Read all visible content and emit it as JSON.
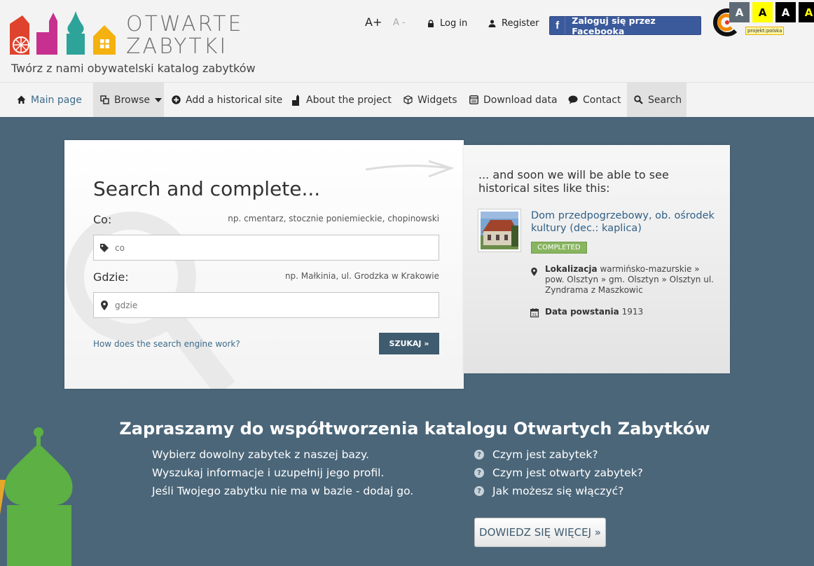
{
  "header": {
    "logo_line1": "OTWARTE",
    "logo_line2": "ZABYTKI",
    "tagline": "Twórz z nami obywatelski katalog zabytków",
    "font_increase": "A+",
    "font_decrease": "A -",
    "login": "Log in",
    "register": "Register",
    "facebook_icon": "f",
    "facebook_login": "Zaloguj się przez Facebooka",
    "partner_logo_text": "projekt:polska",
    "contrast_buttons": [
      "A",
      "A",
      "A",
      "A"
    ]
  },
  "nav": {
    "main": "Main page",
    "browse": "Browse",
    "add": "Add a historical site",
    "about": "About the project",
    "widgets": "Widgets",
    "download": "Download data",
    "contact": "Contact",
    "search": "Search"
  },
  "search": {
    "title": "Search and complete...",
    "co_label": "Co:",
    "co_hint": "np. cmentarz, stocznie poniemieckie, chopinowski",
    "co_placeholder": "co",
    "gdzie_label": "Gdzie:",
    "gdzie_hint": "np. Małkinia, ul. Grodzka w Krakowie",
    "gdzie_placeholder": "gdzie",
    "how_link": "How does the search engine work?",
    "submit": "SZUKAJ »"
  },
  "preview": {
    "heading": "... and soon we will be able to see historical sites like this:",
    "site_title": "Dom przedpogrzebowy, ob. ośrodek kultury (dec.: kaplica)",
    "status": "COMPLETED",
    "location_label": "Lokalizacja",
    "location_value": "warmińsko-mazurskie » pow. Olsztyn » gm. Olsztyn » Olsztyn ul. Zyndrama z Maszkowic",
    "date_label": "Data powstania",
    "date_value": "1913"
  },
  "invite": {
    "title": "Zapraszamy do współtworzenia katalogu Otwartych Zabytków",
    "lines": [
      "Wybierz dowolny zabytek z naszej bazy.",
      "Wyszukaj informacje i uzupełnij jego profil.",
      "Jeśli Twojego zabytku nie ma w bazie - dodaj go."
    ],
    "faq": [
      "Czym jest zabytek?",
      "Czym jest otwarty zabytek?",
      "Jak możesz się włączyć?"
    ],
    "more_button": "DOWIEDZ SIĘ WIĘCEJ »"
  },
  "colors": {
    "background": "#4b6679",
    "header": "#f3f3f3",
    "button_dark": "#3f5b6f",
    "facebook": "#3b5a9c",
    "status_green": "#88b560",
    "link": "#2f5f86"
  },
  "icons": [
    "home-icon",
    "browse-icon",
    "plus-circle-icon",
    "tower-icon",
    "cube-icon",
    "table-icon",
    "speech-bubble-icon",
    "search-icon",
    "lock-icon",
    "user-icon",
    "tag-icon",
    "map-pin-icon",
    "calendar-icon",
    "question-icon"
  ]
}
